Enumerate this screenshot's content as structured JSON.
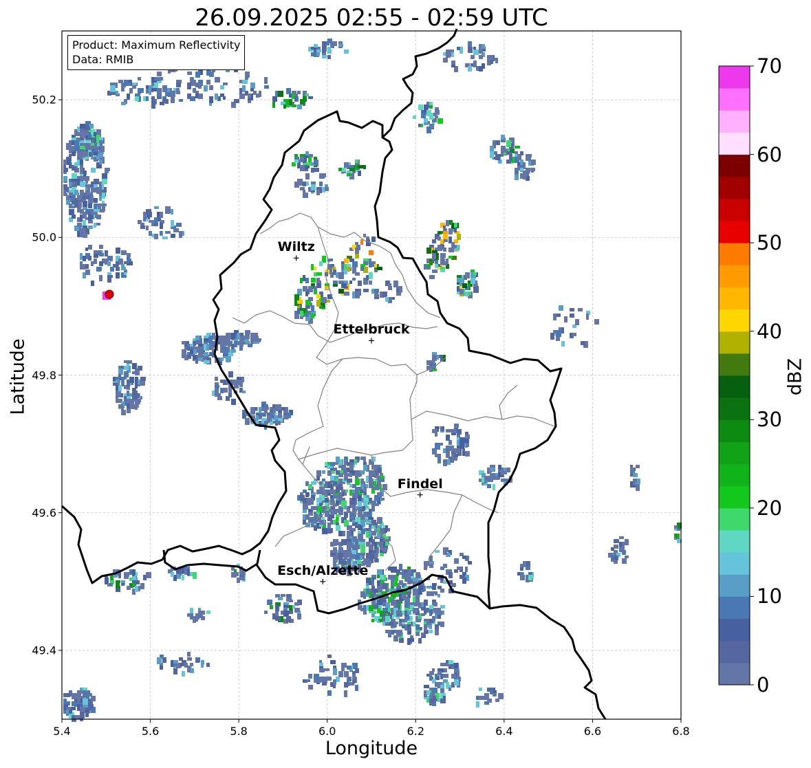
{
  "title": "26.09.2025 02:55 - 02:59 UTC",
  "axes": {
    "xlabel": "Longitude",
    "ylabel": "Latitude",
    "xticks": [
      "5.4",
      "5.6",
      "5.8",
      "6.0",
      "6.2",
      "6.4",
      "6.6",
      "6.8"
    ],
    "yticks": [
      "49.4",
      "49.6",
      "49.8",
      "50.0",
      "50.2"
    ],
    "xlim": [
      5.4,
      6.8
    ],
    "ylim": [
      49.3,
      50.3
    ],
    "grid": true
  },
  "infobox": {
    "line1": "Product: Maximum Reflectivity",
    "line2": "Data: RMIB"
  },
  "cities": [
    {
      "name": "Wiltz",
      "lon": 5.93,
      "lat": 49.97
    },
    {
      "name": "Ettelbruck",
      "lon": 6.1,
      "lat": 49.85
    },
    {
      "name": "Findel",
      "lon": 6.21,
      "lat": 49.626
    },
    {
      "name": "Esch/Alzette",
      "lon": 5.99,
      "lat": 49.5
    }
  ],
  "radar_site": {
    "lon": 5.505,
    "lat": 49.915
  },
  "colorbar": {
    "label": "dBZ",
    "min": 0,
    "max": 70,
    "ticks": [
      "0",
      "10",
      "20",
      "30",
      "40",
      "50",
      "60",
      "70"
    ],
    "colors": [
      "#6476a8",
      "#54679e",
      "#4760a0",
      "#4a78b2",
      "#589ec6",
      "#64c4dc",
      "#5fd7c4",
      "#3ed86c",
      "#12c81c",
      "#10b41a",
      "#12a218",
      "#0d8a12",
      "#0b7210",
      "#066010",
      "#427a10",
      "#b0b200",
      "#ffd700",
      "#ffb700",
      "#ff9a00",
      "#ff7a00",
      "#e80000",
      "#c80000",
      "#a00000",
      "#7c0000",
      "#ffdfff",
      "#ffb0ff",
      "#ff70ff",
      "#ee38ee"
    ]
  },
  "colors": {
    "grid": "#bbbbbb",
    "border": "#000000",
    "admin": "#808080",
    "marker": "#dd0000"
  }
}
